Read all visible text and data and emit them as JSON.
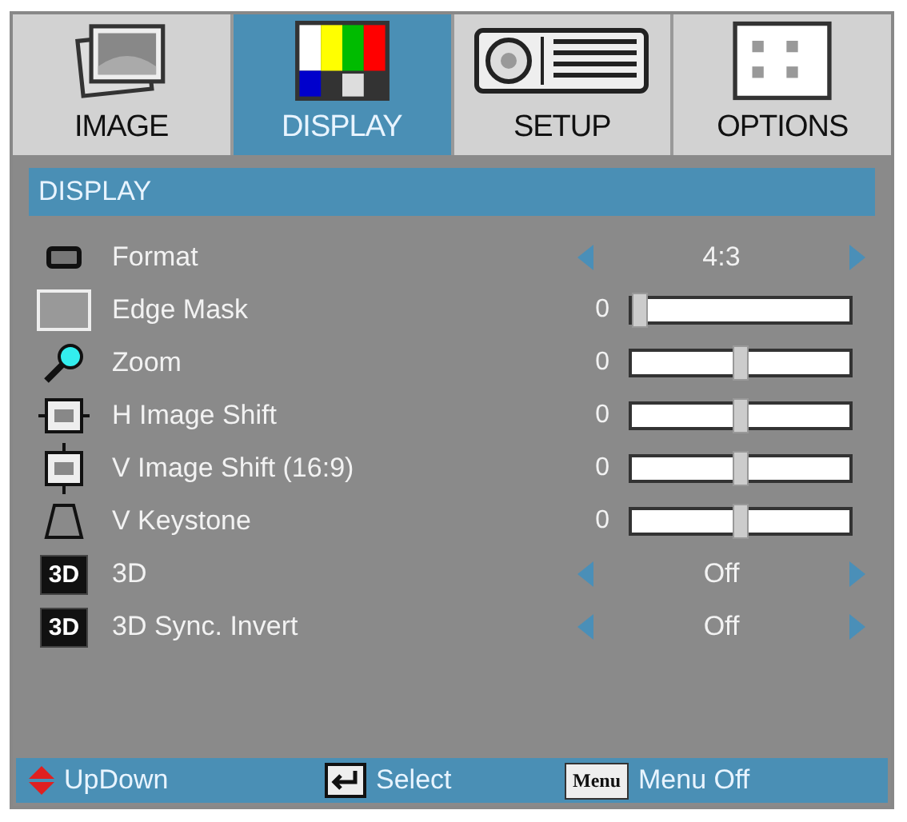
{
  "tabs": [
    {
      "label": "IMAGE",
      "selected": false
    },
    {
      "label": "DISPLAY",
      "selected": true
    },
    {
      "label": "SETUP",
      "selected": false
    },
    {
      "label": "OPTIONS",
      "selected": false
    }
  ],
  "section_title": "DISPLAY",
  "rows": [
    {
      "kind": "choice",
      "label": "Format",
      "value": "4:3"
    },
    {
      "kind": "slider",
      "label": "Edge Mask",
      "value": "0",
      "level": 0.0
    },
    {
      "kind": "slider",
      "label": "Zoom",
      "value": "0",
      "level": 0.5
    },
    {
      "kind": "slider",
      "label": "H Image Shift",
      "value": "0",
      "level": 0.5
    },
    {
      "kind": "slider",
      "label": "V Image Shift (16:9)",
      "value": "0",
      "level": 0.5
    },
    {
      "kind": "slider",
      "label": "V Keystone",
      "value": "0",
      "level": 0.5
    },
    {
      "kind": "choice",
      "label": "3D",
      "badge": "3D",
      "value": "Off"
    },
    {
      "kind": "choice",
      "label": "3D Sync. Invert",
      "badge": "3D",
      "value": "Off"
    }
  ],
  "footer": [
    {
      "kind": "updown",
      "label": "UpDown"
    },
    {
      "kind": "enter",
      "label": "Select"
    },
    {
      "kind": "menu",
      "key": "Menu",
      "label": "Menu Off"
    }
  ]
}
